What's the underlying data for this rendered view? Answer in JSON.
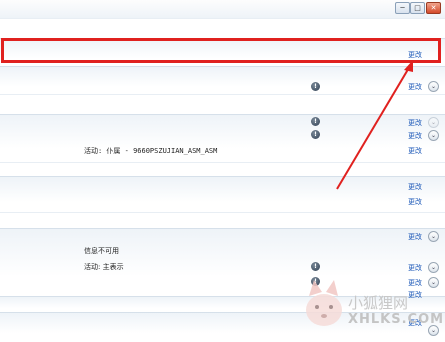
{
  "window": {
    "minimize": "─",
    "maximize": "□",
    "close": "✕"
  },
  "link_label": "更改",
  "rows": {
    "row2_status": "活动: 仆属 - 9660PSZUJIAN_ASM_ASM",
    "row5_info": "信息不可用",
    "row5_status": "活动: 主表示"
  },
  "watermark": {
    "title": "小狐狸网",
    "url": "XHLKS.COM"
  },
  "colors": {
    "highlight": "#e0211f",
    "link": "#1c58b8",
    "arrow": "#e0211f"
  },
  "icons": {
    "shield": "shield-icon",
    "chevron": "chevron-down-icon"
  }
}
